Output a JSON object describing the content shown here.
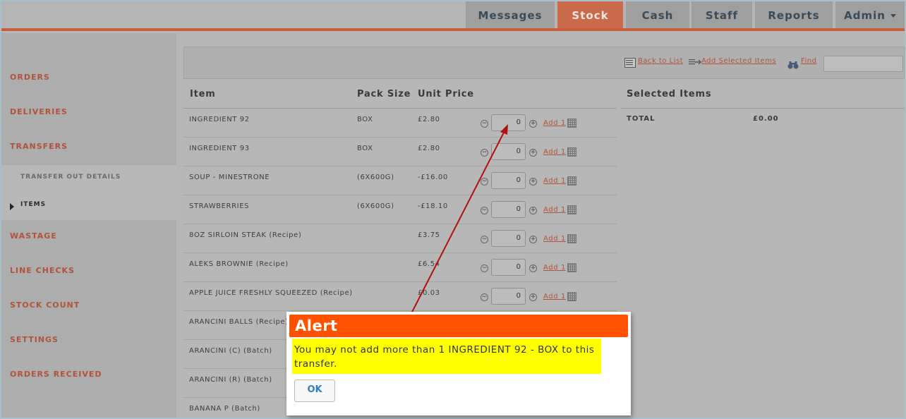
{
  "nav": {
    "tabs": [
      {
        "label": "Messages",
        "active": false
      },
      {
        "label": "Stock",
        "active": true
      },
      {
        "label": "Cash",
        "active": false
      },
      {
        "label": "Staff",
        "active": false
      },
      {
        "label": "Reports",
        "active": false
      },
      {
        "label": "Admin",
        "active": false
      }
    ]
  },
  "sidebar": {
    "items": [
      "ORDERS",
      "DELIVERIES",
      "TRANSFERS",
      "WASTAGE",
      "LINE CHECKS",
      "STOCK COUNT",
      "SETTINGS",
      "ORDERS RECEIVED"
    ],
    "subitems": [
      "TRANSFER OUT DETAILS",
      "ITEMS"
    ]
  },
  "toolbar": {
    "back_label": "Back to List",
    "add_selected_label": "Add Selected Items",
    "find_label": "Find",
    "find_value": ""
  },
  "table": {
    "headers": {
      "item": "Item",
      "pack_size": "Pack Size",
      "unit_price": "Unit Price"
    },
    "add_label": "Add 1",
    "rows": [
      {
        "item": "INGREDIENT 92",
        "pack": "BOX",
        "price": "£2.80",
        "qty": "0"
      },
      {
        "item": "INGREDIENT 93",
        "pack": "BOX",
        "price": "£2.80",
        "qty": "0"
      },
      {
        "item": "SOUP - MINESTRONE",
        "pack": "(6X600G)",
        "price": "-£16.00",
        "qty": "0"
      },
      {
        "item": "STRAWBERRIES",
        "pack": "(6X600G)",
        "price": "-£18.10",
        "qty": "0"
      },
      {
        "item": "8OZ SIRLOIN STEAK (Recipe)",
        "pack": "",
        "price": "£3.75",
        "qty": "0"
      },
      {
        "item": "ALEKS BROWNIE (Recipe)",
        "pack": "",
        "price": "£6.54",
        "qty": "0"
      },
      {
        "item": "APPLE JUICE FRESHLY SQUEEZED (Recipe)",
        "pack": "",
        "price": "£0.03",
        "qty": "0"
      },
      {
        "item": "ARANCINI BALLS (Recipe)",
        "pack": "",
        "price": "",
        "qty": ""
      },
      {
        "item": "ARANCINI (C) (Batch)",
        "pack": "",
        "price": "",
        "qty": ""
      },
      {
        "item": "ARANCINI (R) (Batch)",
        "pack": "",
        "price": "",
        "qty": ""
      },
      {
        "item": "BANANA P (Batch)",
        "pack": "",
        "price": "",
        "qty": ""
      }
    ]
  },
  "selected": {
    "title": "Selected Items",
    "total_label": "TOTAL",
    "total_value": "£0.00"
  },
  "alert": {
    "title": "Alert",
    "message": "You may not add more than 1 INGREDIENT 92 - BOX to this transfer.",
    "ok_label": "OK"
  },
  "colors": {
    "accent": "#c96a4b",
    "alert_header": "#ff5200",
    "alert_highlight": "#ffff00",
    "annotation_arrow": "#b01010"
  }
}
